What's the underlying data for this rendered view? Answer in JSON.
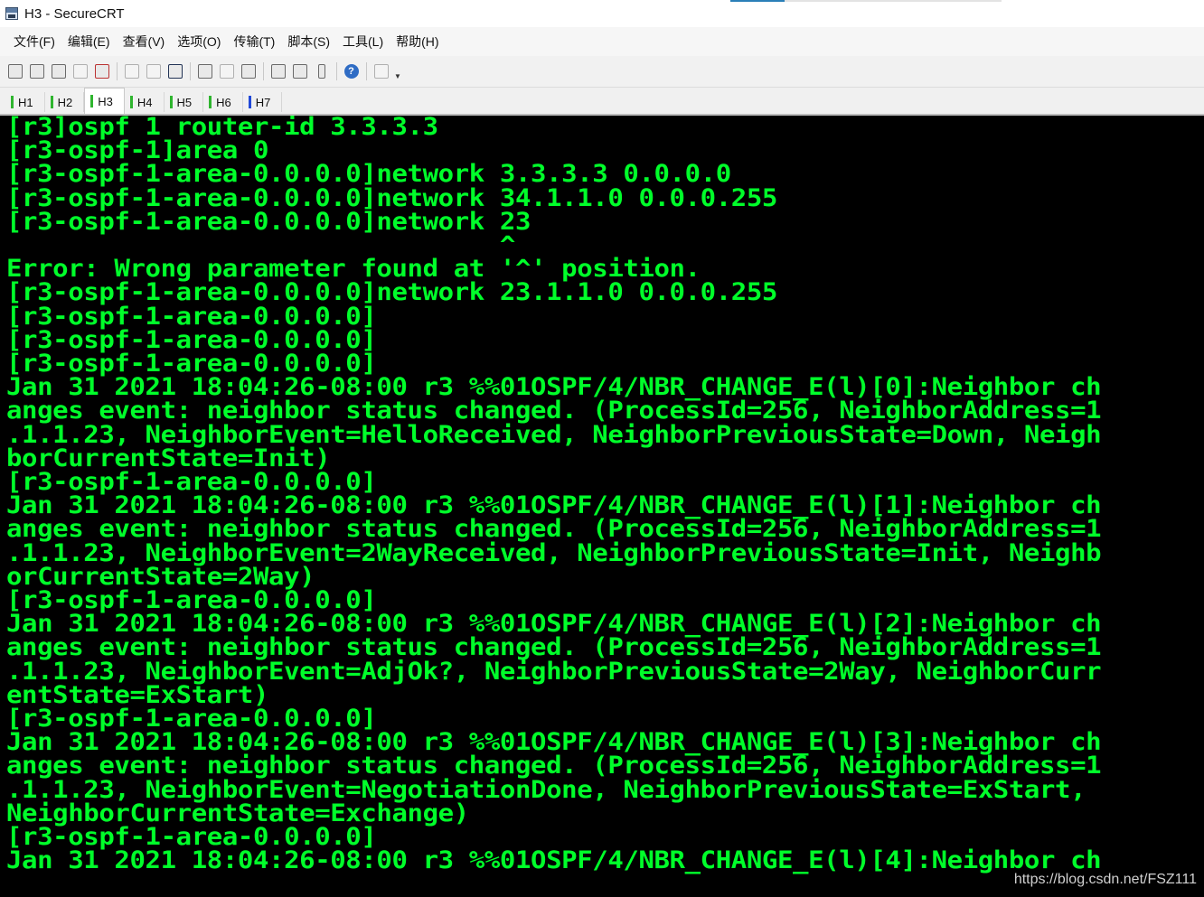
{
  "window": {
    "title": "H3 - SecureCRT"
  },
  "menu": [
    {
      "label": "文件(F)"
    },
    {
      "label": "编辑(E)"
    },
    {
      "label": "查看(V)"
    },
    {
      "label": "选项(O)"
    },
    {
      "label": "传输(T)"
    },
    {
      "label": "脚本(S)"
    },
    {
      "label": "工具(L)"
    },
    {
      "label": "帮助(H)"
    }
  ],
  "toolbar": {
    "icons": [
      "connect-icon",
      "quick-connect-icon",
      "connect-tab-icon",
      "reconnect-icon",
      "disconnect-icon",
      "copy-icon",
      "paste-icon",
      "find-icon",
      "print-setup-icon",
      "print-selection-icon",
      "print-icon",
      "session-options-icon",
      "global-options-icon",
      "keymap-icon",
      "help-icon",
      "sftp-icon"
    ],
    "help_glyph": "?",
    "dropdown_glyph": "▼"
  },
  "tabs": [
    {
      "label": "H1",
      "active": false,
      "color": "#2fb52f"
    },
    {
      "label": "H2",
      "active": false,
      "color": "#2fb52f"
    },
    {
      "label": "H3",
      "active": true,
      "color": "#2fb52f"
    },
    {
      "label": "H4",
      "active": false,
      "color": "#2fb52f"
    },
    {
      "label": "H5",
      "active": false,
      "color": "#2fb52f"
    },
    {
      "label": "H6",
      "active": false,
      "color": "#2fb52f"
    },
    {
      "label": "H7",
      "active": false,
      "color": "#2048d8"
    }
  ],
  "terminal": {
    "fg": "#00ff2a",
    "bg": "#000000",
    "lines": [
      "[r3]ospf 1 router-id 3.3.3.3",
      "[r3-ospf-1]area 0",
      "[r3-ospf-1-area-0.0.0.0]network 3.3.3.3 0.0.0.0",
      "[r3-ospf-1-area-0.0.0.0]network 34.1.1.0 0.0.0.255",
      "[r3-ospf-1-area-0.0.0.0]network 23",
      "                                ^",
      "Error: Wrong parameter found at '^' position.",
      "[r3-ospf-1-area-0.0.0.0]network 23.1.1.0 0.0.0.255",
      "[r3-ospf-1-area-0.0.0.0]",
      "[r3-ospf-1-area-0.0.0.0]",
      "[r3-ospf-1-area-0.0.0.0]",
      "Jan 31 2021 18:04:26-08:00 r3 %%01OSPF/4/NBR_CHANGE_E(l)[0]:Neighbor ch",
      "anges event: neighbor status changed. (ProcessId=256, NeighborAddress=1",
      ".1.1.23, NeighborEvent=HelloReceived, NeighborPreviousState=Down, Neigh",
      "borCurrentState=Init)",
      "[r3-ospf-1-area-0.0.0.0]",
      "Jan 31 2021 18:04:26-08:00 r3 %%01OSPF/4/NBR_CHANGE_E(l)[1]:Neighbor ch",
      "anges event: neighbor status changed. (ProcessId=256, NeighborAddress=1",
      ".1.1.23, NeighborEvent=2WayReceived, NeighborPreviousState=Init, Neighb",
      "orCurrentState=2Way)",
      "[r3-ospf-1-area-0.0.0.0]",
      "Jan 31 2021 18:04:26-08:00 r3 %%01OSPF/4/NBR_CHANGE_E(l)[2]:Neighbor ch",
      "anges event: neighbor status changed. (ProcessId=256, NeighborAddress=1",
      ".1.1.23, NeighborEvent=AdjOk?, NeighborPreviousState=2Way, NeighborCurr",
      "entState=ExStart)",
      "[r3-ospf-1-area-0.0.0.0]",
      "Jan 31 2021 18:04:26-08:00 r3 %%01OSPF/4/NBR_CHANGE_E(l)[3]:Neighbor ch",
      "anges event: neighbor status changed. (ProcessId=256, NeighborAddress=1",
      ".1.1.23, NeighborEvent=NegotiationDone, NeighborPreviousState=ExStart,",
      "NeighborCurrentState=Exchange)",
      "[r3-ospf-1-area-0.0.0.0]",
      "Jan 31 2021 18:04:26-08:00 r3 %%01OSPF/4/NBR_CHANGE_E(l)[4]:Neighbor ch"
    ]
  },
  "watermark": "https://blog.csdn.net/FSZ111"
}
